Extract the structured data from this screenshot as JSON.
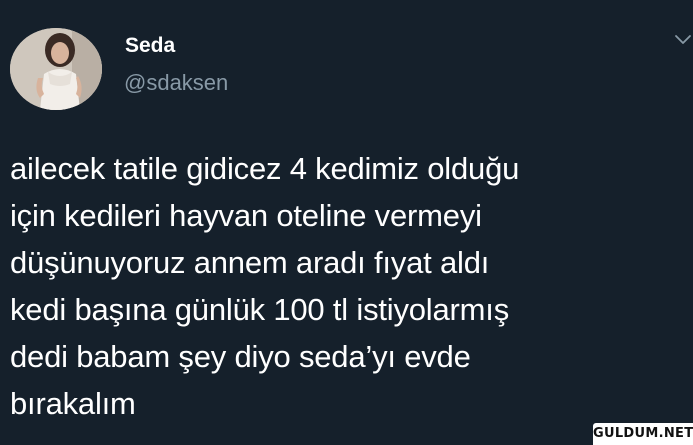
{
  "tweet": {
    "author": {
      "display_name": "Seda",
      "handle": "@sdaksen",
      "avatar_icon": "profile-photo-avatar"
    },
    "text": "ailecek tatile gidicez 4 kedimiz olduğu\niçin kedileri hayvan oteline vermeyi\ndüşünuyoruz annem aradı fıyat aldı\nkedi başına günlük 100 tl istiyolarmış\ndedi babam şey diyo seda’yı evde\nbırakalım",
    "menu_icon": "chevron-down-icon"
  },
  "watermark": {
    "text": "GULDUM.NET"
  },
  "colors": {
    "background": "#15202b",
    "secondary_text": "#8899a6",
    "primary_text": "#ffffff"
  }
}
